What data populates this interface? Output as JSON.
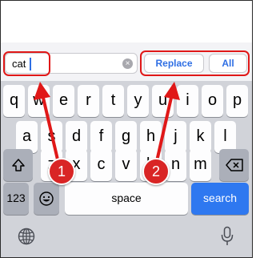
{
  "search": {
    "value": "cat"
  },
  "toolbar": {
    "replace_label": "Replace",
    "all_label": "All"
  },
  "keyboard": {
    "row1": [
      "q",
      "w",
      "e",
      "r",
      "t",
      "y",
      "u",
      "i",
      "o",
      "p"
    ],
    "row2": [
      "a",
      "s",
      "d",
      "f",
      "g",
      "h",
      "j",
      "k",
      "l"
    ],
    "row3": [
      "z",
      "x",
      "c",
      "v",
      "b",
      "n",
      "m"
    ],
    "numbers_label": "123",
    "space_label": "space",
    "search_label": "search"
  },
  "annotations": {
    "badge1": "1",
    "badge2": "2"
  },
  "colors": {
    "highlight": "#e01818",
    "accent": "#2e78f0"
  }
}
